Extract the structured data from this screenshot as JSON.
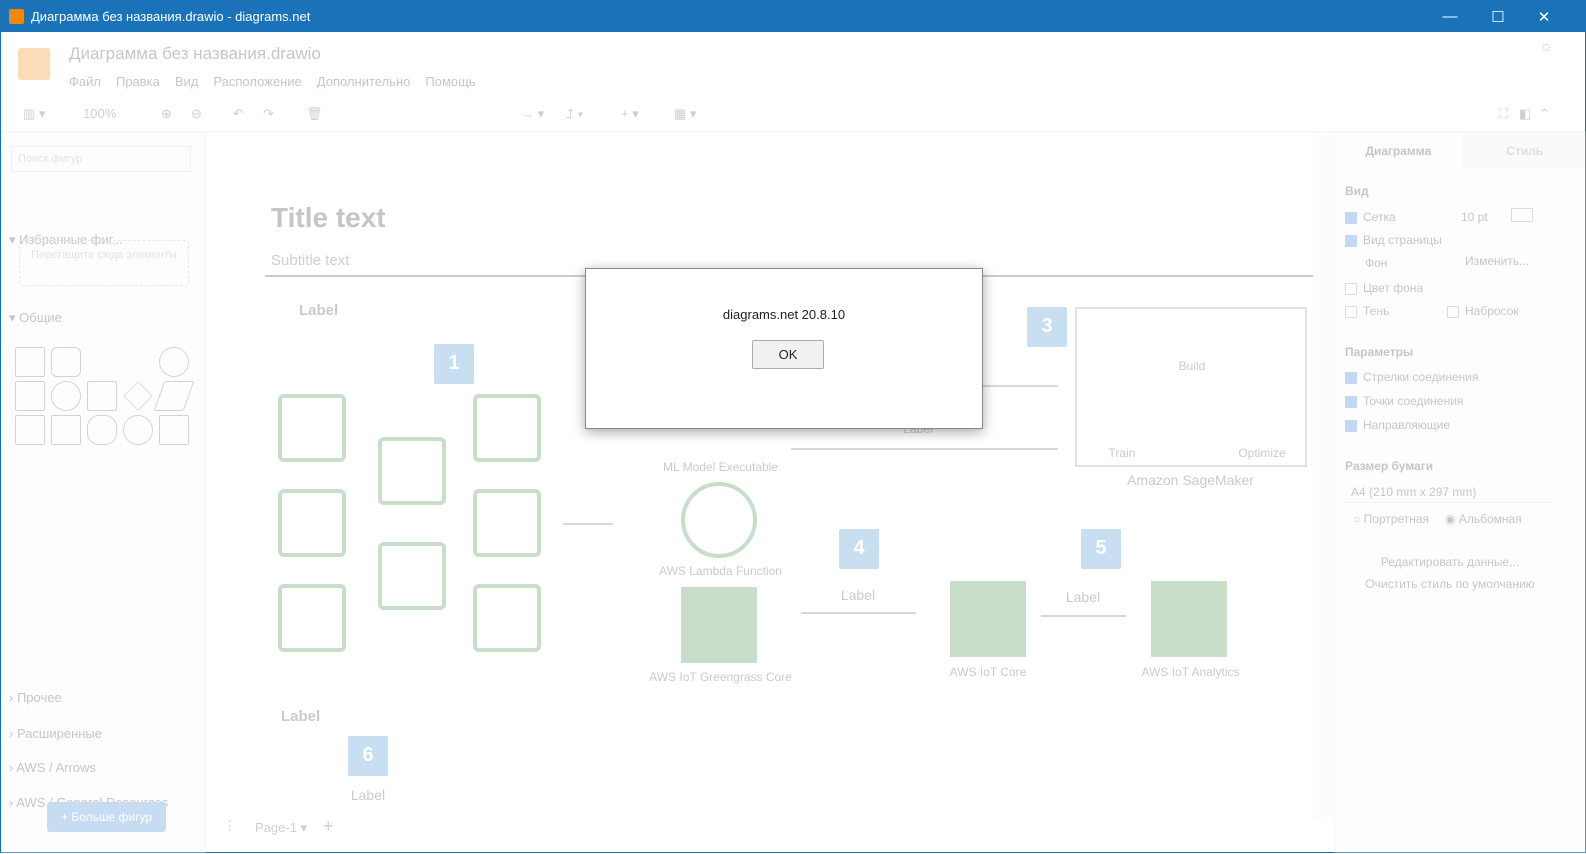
{
  "window": {
    "title": "Диаграмма без названия.drawio - diagrams.net",
    "minimize": "—",
    "maximize": "☐",
    "close": "✕"
  },
  "app": {
    "doc_name": "Диаграмма без названия.drawio",
    "menu": [
      "Файл",
      "Правка",
      "Вид",
      "Расположение",
      "Дополнительно",
      "Помощь"
    ],
    "zoom": "100%"
  },
  "left_panel": {
    "search_placeholder": "Поиск фигур",
    "favorites": "Избранные фиг...",
    "dropzone": "Перетащите сюда элементы",
    "general": "Общие",
    "other": "Прочее",
    "advanced": "Расширенные",
    "aws_arrows": "AWS / Arrows",
    "aws_general": "AWS / General Resources",
    "more_shapes": "+ Больше фигур"
  },
  "canvas": {
    "title": "Title text",
    "subtitle": "Subtitle text",
    "labels": {
      "l1": "Label",
      "l2": "Label",
      "l3": "Label",
      "l4": "Label",
      "l5": "Label",
      "l6": "Label"
    },
    "badges": [
      "1",
      "3",
      "4",
      "5",
      "6"
    ],
    "services": {
      "ml": "ML Model Executable",
      "lambda": "AWS Lambda Function",
      "greengrass": "AWS IoT Greengrass Core",
      "iot_core": "AWS IoT Core",
      "iot_analytics": "AWS IoT Analytics",
      "sagemaker": "Amazon SageMaker",
      "build": "Build",
      "train": "Train",
      "optimize": "Optimize"
    },
    "page_tab": "Page-1"
  },
  "right_panel": {
    "tab_diagram": "Диаграмма",
    "tab_style": "Стиль",
    "view": "Вид",
    "grid": "Сетка",
    "grid_size": "10 pt",
    "page_view": "Вид страницы",
    "background": "Фон",
    "change": "Изменить...",
    "bg_color": "Цвет фона",
    "shadow": "Тень",
    "sketch": "Набросок",
    "options": "Параметры",
    "conn_arrows": "Стрелки соединения",
    "conn_points": "Точки соединения",
    "guides": "Направляющие",
    "paper_size": "Размер бумаги",
    "paper_value": "A4 (210 mm x 297 mm)",
    "portrait": "Портретная",
    "landscape": "Альбомная",
    "edit_data": "Редактировать данные...",
    "clear_style": "Очистить стиль по умолчанию"
  },
  "dialog": {
    "message": "diagrams.net 20.8.10",
    "ok": "OK"
  }
}
